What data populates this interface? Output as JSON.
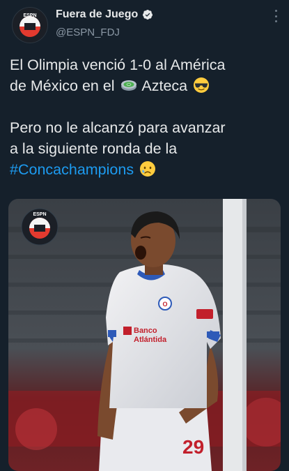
{
  "account": {
    "display_name": "Fuera de Juego",
    "handle": "@ESPN_FDJ",
    "avatar_logo_text": "ESPN"
  },
  "tweet": {
    "line1_a": "El Olimpia venció 1-0 al América",
    "line1_b": "de México en el",
    "line1_c": "Azteca",
    "line2_a": "Pero no le alcanzó para avanzar",
    "line2_b": "a la siguiente ronda de la",
    "hashtag": "#Concachampions"
  },
  "media": {
    "jersey_sponsor": "Banco",
    "jersey_sponsor_2": "Atlántida",
    "shorts_number": "29",
    "watermark_logo_text": "ESPN"
  },
  "colors": {
    "background": "#15202b",
    "link": "#1d9bf0",
    "verified": "#e7e9ea"
  },
  "icons": [
    "verified-badge-icon",
    "more-options-icon",
    "stadium-emoji-icon",
    "cool-face-emoji-icon",
    "sad-face-emoji-icon"
  ]
}
